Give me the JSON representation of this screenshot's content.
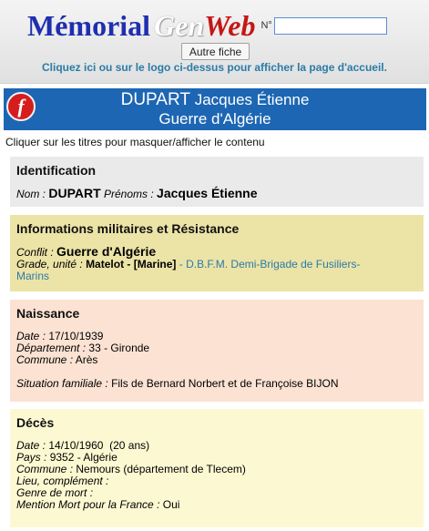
{
  "header": {
    "logo_part1": "Mémorial",
    "logo_part2": "Gen",
    "logo_part3": "Web",
    "number_label": "N°",
    "number_value": "",
    "other_button": "Autre fiche",
    "home_link": "Cliquez ici ou sur le logo ci-dessus pour afficher la page d'accueil."
  },
  "title": {
    "badge": "f",
    "surname": "DUPART",
    "given_names": "Jacques Étienne",
    "conflict": "Guerre d'Algérie"
  },
  "hint": "Cliquer sur les titres pour masquer/afficher le contenu",
  "identification": {
    "title": "Identification",
    "nom_label": "Nom :",
    "nom": "DUPART",
    "prenoms_label": "Prénoms :",
    "prenoms": "Jacques Étienne"
  },
  "military": {
    "title": "Informations militaires et Résistance",
    "conflit_label": "Conflit :",
    "conflit": "Guerre d'Algérie",
    "grade_label": "Grade, unité :",
    "grade": "Matelot - [Marine]",
    "unit_sep": "-",
    "unit_line1": "D.B.F.M. Demi-Brigade de Fusiliers-",
    "unit_line2": "Marins"
  },
  "birth": {
    "title": "Naissance",
    "date_label": "Date :",
    "date": "17/10/1939",
    "dept_label": "Département :",
    "dept": "33 - Gironde",
    "commune_label": "Commune :",
    "commune": "Arès",
    "family_label": "Situation familiale :",
    "family": "Fils de Bernard Norbert et de Françoise BIJON"
  },
  "death": {
    "title": "Décès",
    "date_label": "Date :",
    "date": "14/10/1960  (20 ans)",
    "pays_label": "Pays :",
    "pays": "9352 - Algérie",
    "commune_label": "Commune :",
    "commune": "Nemours (département de Tlecem)",
    "lieu_label": "Lieu, complément :",
    "genre_label": "Genre de mort :",
    "mention_label": "Mention Mort pour la France :",
    "mention": "Oui"
  }
}
